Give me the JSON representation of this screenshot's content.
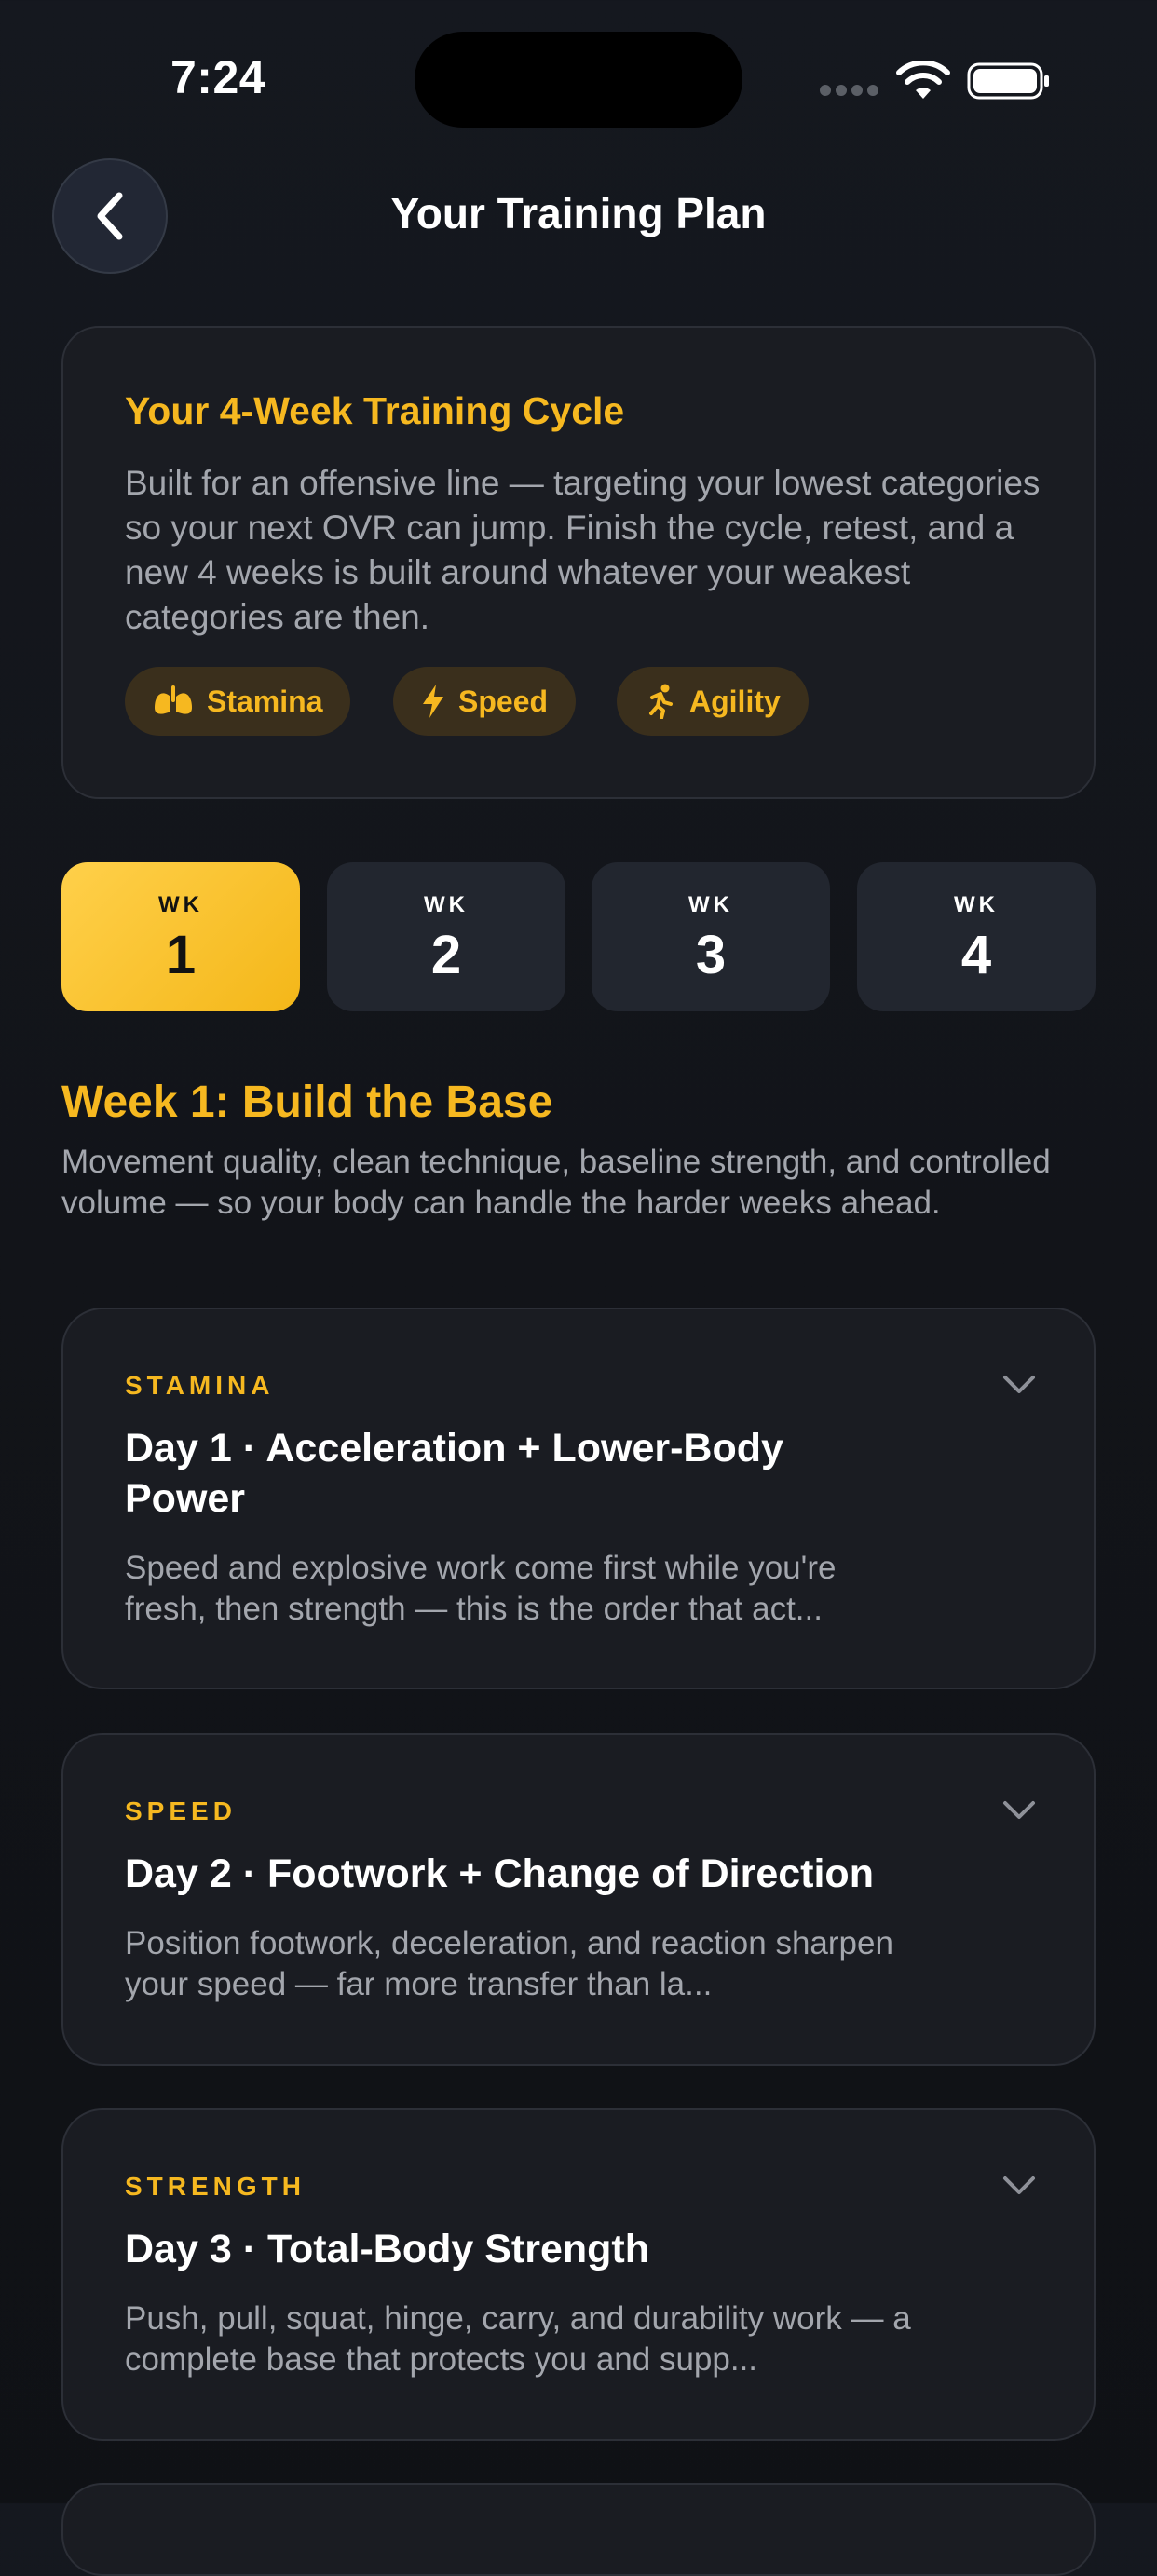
{
  "status_bar": {
    "time": "7:24"
  },
  "header": {
    "title": "Your Training Plan",
    "back_icon": "chevron-left-icon"
  },
  "cycle": {
    "title": "Your 4-Week Training Cycle",
    "description": "Built for an offensive line — targeting your lowest categories so your next OVR can jump. Finish the cycle, retest, and a new 4 weeks is built around whatever your weakest categories are then.",
    "tags": [
      {
        "label": "Stamina",
        "icon": "lungs-icon"
      },
      {
        "label": "Speed",
        "icon": "bolt-icon"
      },
      {
        "label": "Agility",
        "icon": "runner-icon"
      }
    ]
  },
  "weeks": {
    "prefix": "WK",
    "items": [
      "1",
      "2",
      "3",
      "4"
    ],
    "selected": "1"
  },
  "week_detail": {
    "heading": "Week 1: Build the Base",
    "description": "Movement quality, clean technique, baseline strength, and controlled volume — so your body can handle the harder weeks ahead."
  },
  "days": [
    {
      "category": "STAMINA",
      "title": "Day 1 · Acceleration + Lower-Body Power",
      "summary": "Speed and explosive work come first while you're fresh, then strength — this is the order that act..."
    },
    {
      "category": "SPEED",
      "title": "Day 2 · Footwork + Change of Direction",
      "summary": "Position footwork, deceleration, and reaction sharpen your speed — far more transfer than la..."
    },
    {
      "category": "STRENGTH",
      "title": "Day 3 · Total-Body Strength",
      "summary": "Push, pull, squat, hinge, carry, and durability work — a complete base that protects you and supp..."
    }
  ],
  "colors": {
    "accent": "#f6b820",
    "background": "#121419",
    "card": "#1a1c22",
    "muted_text": "#a3a6ad"
  }
}
